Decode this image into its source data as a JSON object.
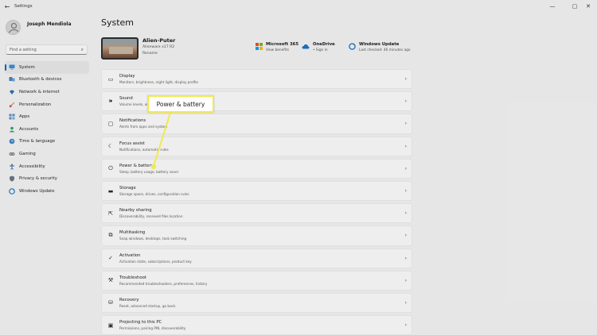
{
  "app": {
    "title": "Settings"
  },
  "profile": {
    "name": "Joseph Mendiola"
  },
  "search": {
    "placeholder": "Find a setting"
  },
  "sidebar": {
    "items": [
      {
        "label": "System",
        "icon": "monitor-icon"
      },
      {
        "label": "Bluetooth & devices",
        "icon": "bluetooth-icon"
      },
      {
        "label": "Network & internet",
        "icon": "wifi-icon"
      },
      {
        "label": "Personalization",
        "icon": "brush-icon"
      },
      {
        "label": "Apps",
        "icon": "apps-icon"
      },
      {
        "label": "Accounts",
        "icon": "person-icon"
      },
      {
        "label": "Time & language",
        "icon": "globe-clock-icon"
      },
      {
        "label": "Gaming",
        "icon": "gamepad-icon"
      },
      {
        "label": "Accessibility",
        "icon": "accessibility-icon"
      },
      {
        "label": "Privacy & security",
        "icon": "shield-icon"
      },
      {
        "label": "Windows Update",
        "icon": "update-icon"
      }
    ]
  },
  "main": {
    "title": "System",
    "device": {
      "name": "Alien-Puter",
      "model": "Alienware x17 R2",
      "rename": "Rename"
    },
    "cards": [
      {
        "title": "Microsoft 365",
        "subtitle": "View benefits"
      },
      {
        "title": "OneDrive",
        "subtitle": "• Sign in"
      },
      {
        "title": "Windows Update",
        "subtitle": "Last checked: 46 minutes ago"
      }
    ],
    "rows": [
      {
        "title": "Display",
        "subtitle": "Monitors, brightness, night light, display profile",
        "icon": "display-icon"
      },
      {
        "title": "Sound",
        "subtitle": "Volume levels, output, input, sound devices",
        "icon": "speaker-icon"
      },
      {
        "title": "Notifications",
        "subtitle": "Alerts from apps and system",
        "icon": "bell-icon"
      },
      {
        "title": "Focus assist",
        "subtitle": "Notifications, automatic rules",
        "icon": "moon-icon"
      },
      {
        "title": "Power & battery",
        "subtitle": "Sleep, battery usage, battery saver",
        "icon": "power-icon"
      },
      {
        "title": "Storage",
        "subtitle": "Storage space, drives, configuration rules",
        "icon": "storage-icon"
      },
      {
        "title": "Nearby sharing",
        "subtitle": "Discoverability, received files location",
        "icon": "share-icon"
      },
      {
        "title": "Multitasking",
        "subtitle": "Snap windows, desktops, task switching",
        "icon": "multitask-icon"
      },
      {
        "title": "Activation",
        "subtitle": "Activation state, subscriptions, product key",
        "icon": "activation-icon"
      },
      {
        "title": "Troubleshoot",
        "subtitle": "Recommended troubleshooters, preferences, history",
        "icon": "wrench-icon"
      },
      {
        "title": "Recovery",
        "subtitle": "Reset, advanced startup, go back",
        "icon": "recovery-icon"
      },
      {
        "title": "Projecting to this PC",
        "subtitle": "Permissions, pairing PIN, discoverability",
        "icon": "projector-icon"
      }
    ]
  },
  "callout": {
    "text": "Power & battery",
    "border_color": "#f2e94e"
  },
  "accent_color": "#0067c0"
}
